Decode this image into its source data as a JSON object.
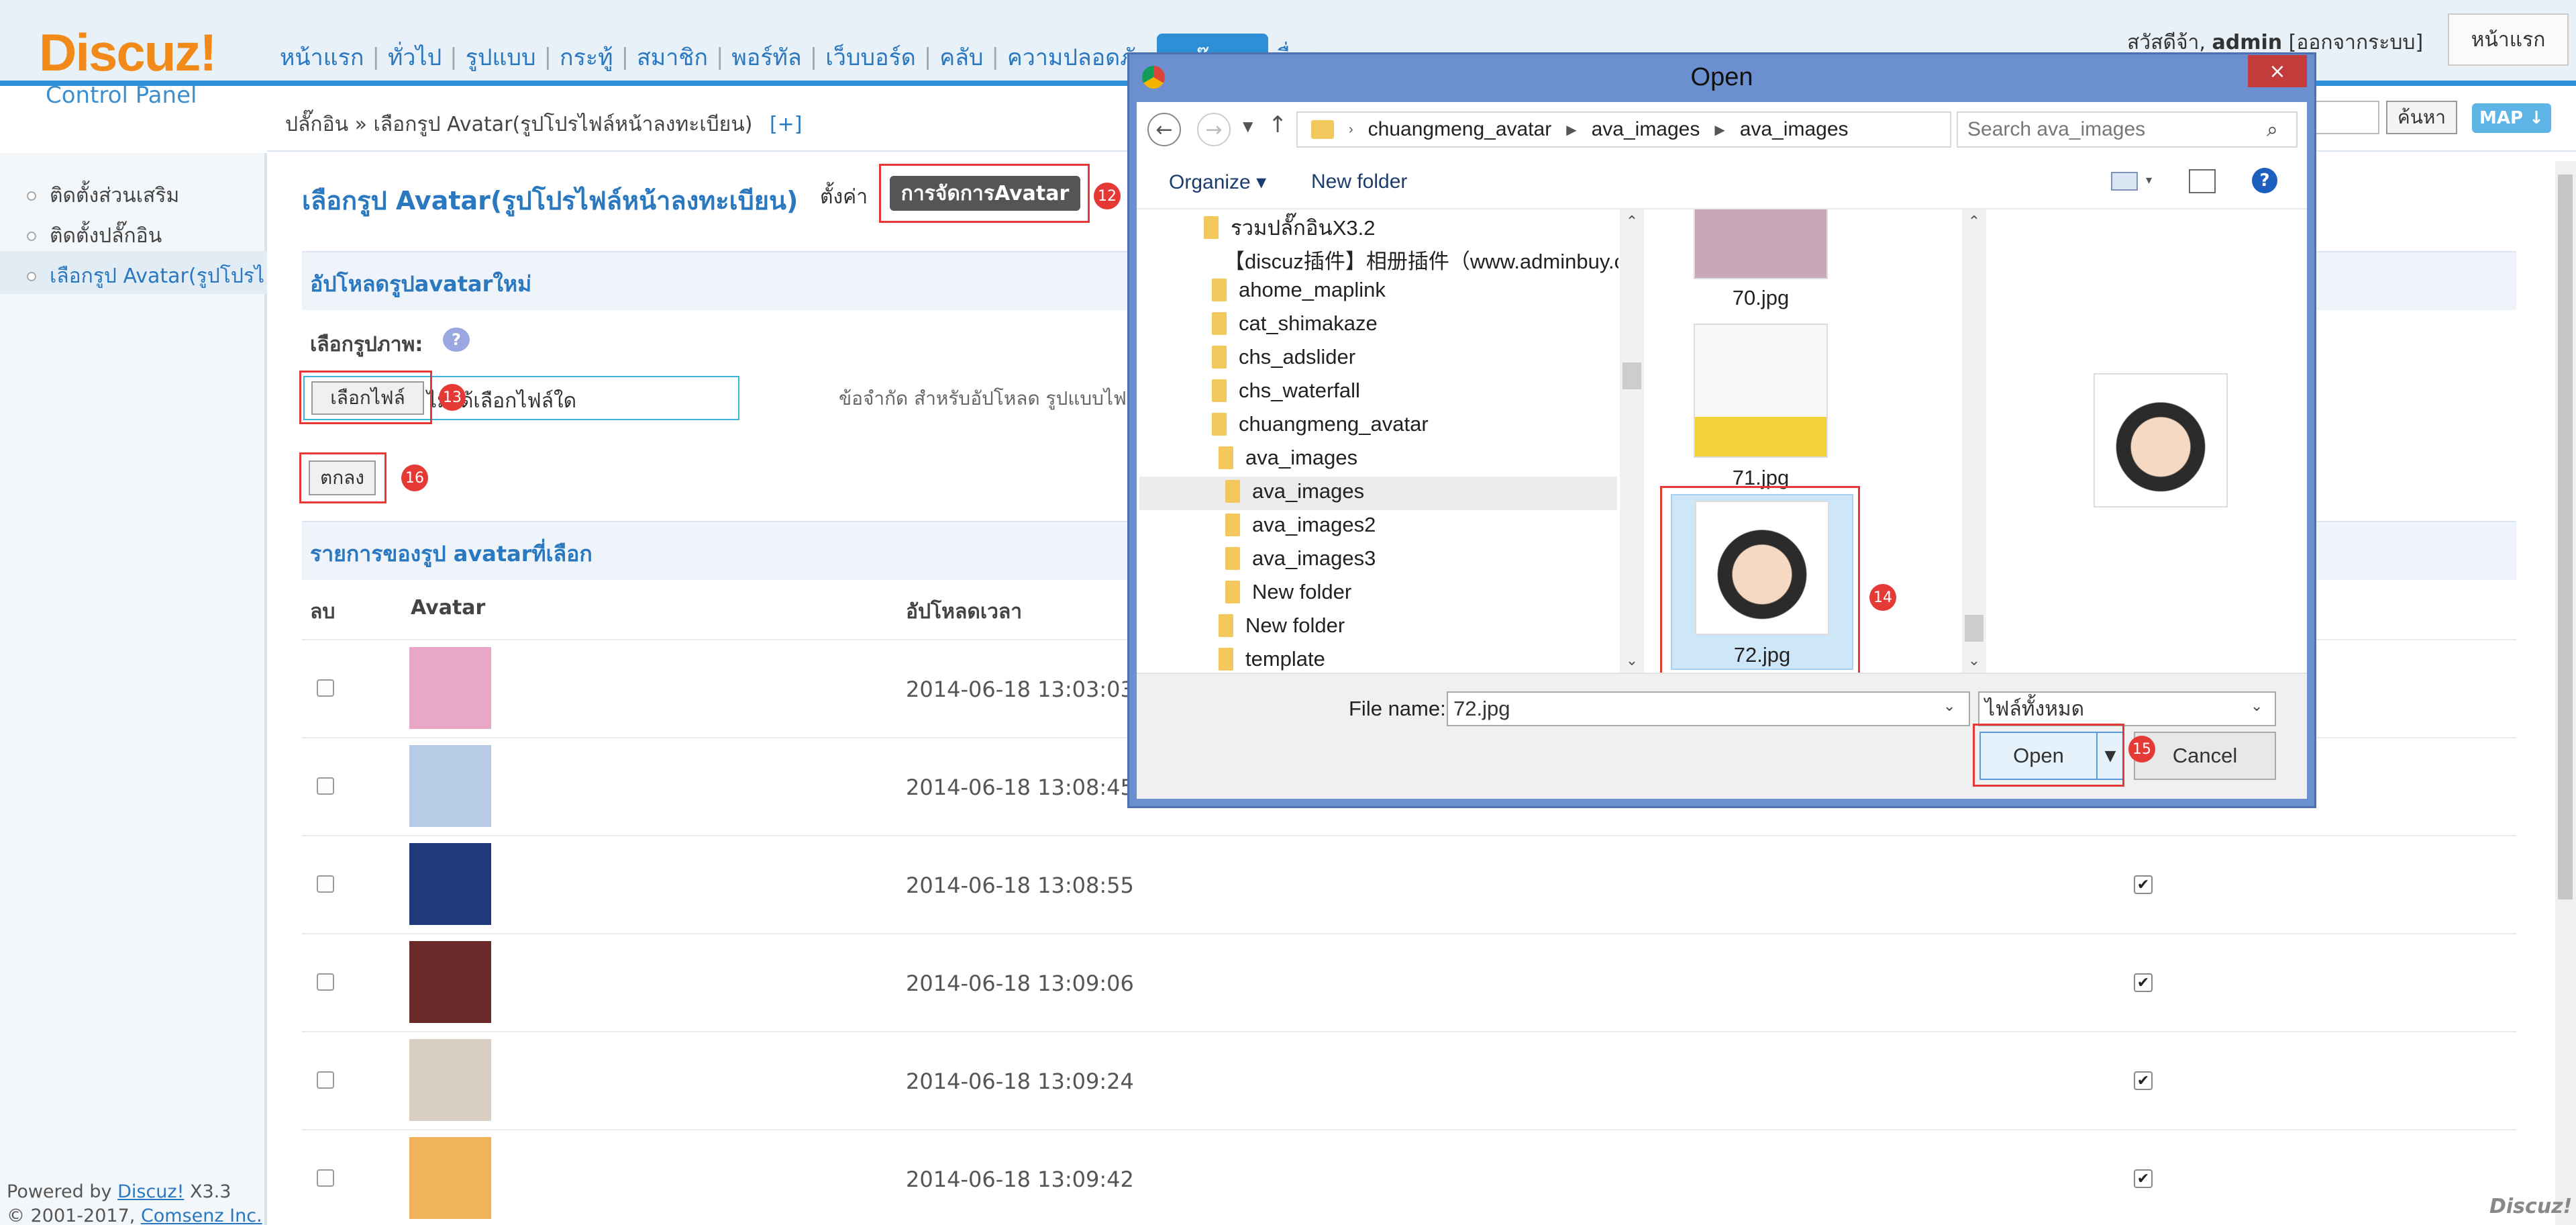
{
  "logo": {
    "brand": "Discuz!",
    "subtitle": "Control Panel"
  },
  "nav": {
    "items": [
      "หน้าแรก",
      "ทั่วไป",
      "รูปแบบ",
      "กระทู้",
      "สมาชิก",
      "พอร์ทัล",
      "เว็บบอร์ด",
      "คลับ",
      "ความปลอดภัย"
    ],
    "active_label": "ปลั๊กอิน",
    "trailing": "อื่นๆ"
  },
  "user": {
    "greeting": "สวัสดีจ้า,",
    "name": "admin",
    "logout": "[ออกจากระบบ]",
    "home_button": "หน้าแรก"
  },
  "breadcrumb": {
    "text": "ปลั๊กอิน » เลือกรูป Avatar(รูปโปรไฟล์หน้าลงทะเบียน)",
    "plus": "[+]"
  },
  "search": {
    "button": "ค้นหา",
    "map": "MAP ↓"
  },
  "sidebar": {
    "items": [
      "ติดตั้งส่วนเสริม",
      "ติดตั้งปลั๊กอิน",
      "เลือกรูป Avatar(รูปโปรไ"
    ]
  },
  "footer": {
    "powered": "Powered by",
    "product": "Discuz!",
    "version": "X3.3",
    "copyright": "© 2001-2017,",
    "company": "Comsenz Inc."
  },
  "main": {
    "title": "เลือกรูป Avatar(รูปโปรไฟล์หน้าลงทะเบียน)",
    "setting_label": "ตั้งค่า",
    "manage_button": "การจัดการAvatar",
    "upload_section": "อัปโหลดรูปavatarใหม่",
    "choose_label": "เลือกรูปภาพ:",
    "help": "?",
    "file_button": "เลือกไฟล์",
    "file_none": "ไม่ได้เลือกไฟล์ใด",
    "limit_text": "ข้อจำกัด สำหรับอัปโหลด รูปแบบไฟ",
    "ok_button": "ตกลง",
    "list_section": "รายการของรูป avatarที่เลือก",
    "columns": {
      "delete": "ลบ",
      "avatar": "Avatar",
      "upload_time": "อัปโหลดเวลา"
    },
    "rows": [
      {
        "time": "2014-06-18 13:03:03",
        "checked": false,
        "avatar_icon": "anime-girl-avatar",
        "color": "#e9a7c7"
      },
      {
        "time": "2014-06-18 13:08:45",
        "checked": false,
        "avatar_icon": "cartoon-boy-avatar",
        "color": "#b7cbe6"
      },
      {
        "time": "2014-06-18 13:08:55",
        "checked": true,
        "avatar_icon": "superman-logo-avatar",
        "color": "#1e3a7a"
      },
      {
        "time": "2014-06-18 13:09:06",
        "checked": true,
        "avatar_icon": "rock-star-avatar",
        "color": "#6b2a2a"
      },
      {
        "time": "2014-06-18 13:09:24",
        "checked": true,
        "avatar_icon": "bulldog-avatar",
        "color": "#d8cfc2"
      },
      {
        "time": "2014-06-18 13:09:42",
        "checked": true,
        "avatar_icon": "bear-couple-avatar",
        "color": "#f0b35a"
      }
    ]
  },
  "annotations": [
    "12",
    "13",
    "14",
    "15",
    "16"
  ],
  "dialog": {
    "title": "Open",
    "close": "×",
    "path": [
      "chuangmeng_avatar",
      "ava_images",
      "ava_images"
    ],
    "search_placeholder": "Search ava_images",
    "organize": "Organize ▾",
    "new_folder": "New folder",
    "help": "?",
    "tree": [
      "รวมปลั๊กอินX3.2",
      "【discuz插件】相册插件（www.adminbuy.cn）",
      "ahome_maplink",
      "cat_shimakaze",
      "chs_adslider",
      "chs_waterfall",
      "chuangmeng_avatar",
      "ava_images",
      "ava_images",
      "ava_images2",
      "ava_images3",
      "New folder",
      "New folder",
      "template"
    ],
    "files": [
      {
        "name": "70.jpg",
        "icon": "woman-cartoon-thumbnail"
      },
      {
        "name": "71.jpg",
        "icon": "woman-yellow-jacket-thumbnail"
      },
      {
        "name": "72.jpg",
        "icon": "short-hair-woman-thumbnail"
      }
    ],
    "file_name_label": "File name:",
    "file_name_value": "72.jpg",
    "file_type": "ไฟล์ทั้งหมด",
    "open_button": "Open",
    "cancel_button": "Cancel"
  },
  "corner_logo": "Discuz!"
}
